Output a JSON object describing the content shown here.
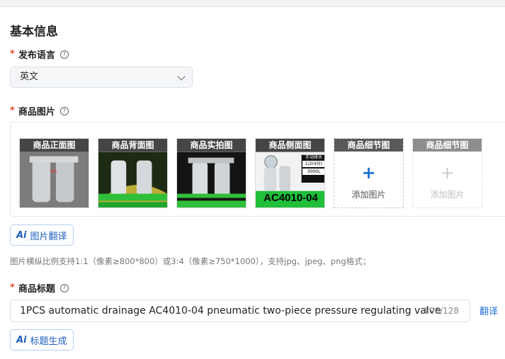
{
  "section": {
    "title": "基本信息"
  },
  "language": {
    "label": "发布语言",
    "required": "*",
    "help": "?",
    "selected": "英文"
  },
  "images": {
    "label": "商品图片",
    "required": "*",
    "help": "?",
    "slots": [
      {
        "caption": "商品正面图"
      },
      {
        "caption": "商品背面图"
      },
      {
        "caption": "商品实拍图"
      },
      {
        "caption": "商品侧面图",
        "overlay_text": "AC4010-04",
        "tag_top": "手动排水",
        "tag_mid": "1/2(4分)",
        "tag_bottom": "3000L"
      },
      {
        "caption": "商品细节图",
        "plus": "+",
        "add_text": "添加图片"
      },
      {
        "caption": "商品细节图",
        "plus": "+",
        "add_text": "添加图片"
      }
    ],
    "translate_button": "图片翻译",
    "hint": "图片横纵比例支持1:1（像素≥800*800）或3:4（像素≥750*1000），支持jpg、jpeg、png格式；"
  },
  "title": {
    "label": "商品标题",
    "required": "*",
    "help": "?",
    "value": "1PCS automatic drainage AC4010-04 pneumatic two-piece pressure regulating valve",
    "counter": "106/128",
    "translate_link": "翻译",
    "generate_button": "标题生成"
  },
  "ai_mark": "Ai",
  "colors": {
    "accent": "#1f6fd8",
    "required": "#e5482e"
  }
}
